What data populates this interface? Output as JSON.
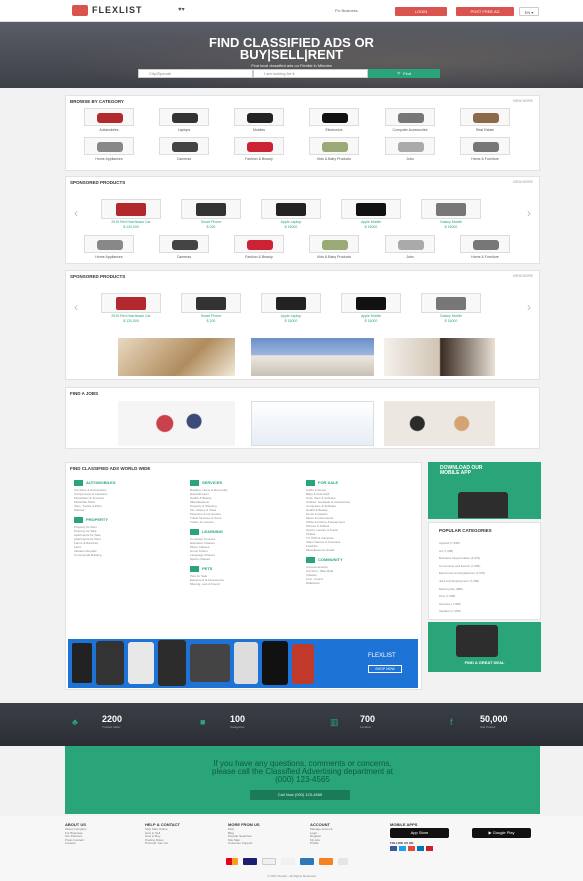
{
  "header": {
    "logo_text": "FLEXLIST",
    "link_label": "Fix Business",
    "login_label": "LOGIN",
    "post_label": "POST FREE AD",
    "lang_label": "EN ▾"
  },
  "hero": {
    "title_line1": "FIND CLASSIFIED ADS OR",
    "title_line2": "BUY|SELL|RENT",
    "subtitle": "Find local classified ads on Flexlist in Minutes",
    "city_placeholder": "City/Zipcode",
    "keyword_placeholder": "I am looking for it",
    "search_label": "Find"
  },
  "categories": {
    "title": "BROWSE BY CATEGORY",
    "more": "VIEW MORE",
    "row1": [
      "Automobiles",
      "Laptops",
      "Mobiles",
      "Electronics",
      "Computer Accessories",
      "Real Estate"
    ],
    "row2": [
      "Home Appliances",
      "Cameras",
      "Fashion & Beauty",
      "Kids & Baby Products",
      "Jobs",
      "Home & Furniture"
    ]
  },
  "sponsored1": {
    "title": "SPONSORED PRODUCTS",
    "more": "VIEW MORE",
    "products": [
      {
        "name": "2019 Red Hatchback Car",
        "price": "$ 120,000"
      },
      {
        "name": "Smart Phone",
        "price": "$ 200"
      },
      {
        "name": "Apple Laptop",
        "price": "$ 15000"
      },
      {
        "name": "Apple Mobile",
        "price": "$ 15000"
      },
      {
        "name": "Galaxy Mobile",
        "price": "$ 15000"
      }
    ],
    "row2": [
      "Home Appliances",
      "Cameras",
      "Fashion & Beauty",
      "Kids & Baby Products",
      "Jobs",
      "Home & Furniture"
    ]
  },
  "sponsored2": {
    "title": "SPONSORED PRODUCTS",
    "more": "VIEW MORE",
    "products": [
      {
        "name": "2019 Red Hatchback Car",
        "price": "$ 120,000"
      },
      {
        "name": "Smart Phone",
        "price": "$ 200"
      },
      {
        "name": "Apple Laptop",
        "price": "$ 15000"
      },
      {
        "name": "Apple Mobile",
        "price": "$ 15000"
      },
      {
        "name": "Galaxy Mobile",
        "price": "$ 15000"
      }
    ]
  },
  "jobs": {
    "title": "FIND A JOBS"
  },
  "worldwide": {
    "title": "FIND CLASSIFIED ADS WORLD WIDE",
    "columns": [
      {
        "heading": "AUTOMOBILES",
        "items": [
          "Car Parts & Accessories",
          "Campervans & Caravans",
          "Motorbikes & Scooters",
          "Motorbike Parts",
          "Vans, Trucks & Plant",
          "Wanted"
        ],
        "heading2": "PROPERTY",
        "items2": [
          "Property for Rent",
          "Property for Sale",
          "Apartments for Sale",
          "Apartments for Rent",
          "Farms & Ranches",
          "Land",
          "Vacation Rentals",
          "Commercial Building"
        ]
      },
      {
        "heading": "SERVICES",
        "items": [
          "Building, Home & Removals",
          "Entertainment",
          "Health & Beauty",
          "Miscellaneous",
          "Property & Shipping",
          "Tax, Money & Visas",
          "Telecoms & Computers",
          "Travel Services & Tours",
          "Tuition & Lessons"
        ],
        "heading2": "LEARNING",
        "items2": [
          "Computer Courses",
          "Education Classes",
          "Music Classes",
          "Home Tuition",
          "Language Classes",
          "Sports Classes"
        ],
        "heading3": "PETS",
        "items3": [
          "Pets for Sale",
          "Equipment & Accessories",
          "Missing, Lost & Found"
        ]
      },
      {
        "heading": "FOR SALE",
        "items": [
          "Audio & Stereo",
          "Baby & Kids Stuff",
          "Cars, Vans & Vehicles",
          "Clothes, Footwear & Accessories",
          "Computers & Software",
          "Health & Beauty",
          "Home & Garden",
          "Music & Instruments",
          "Office Furniture & Equipment",
          "Phones & Tablets",
          "Sports, Leisure & Travel",
          "Tickets",
          "TV, DVD & Cameras",
          "Video Games & Consoles",
          "Freebies",
          "Miscellaneous Goods"
        ],
        "heading2": "COMMUNITY",
        "items2": [
          "Announcements",
          "Car Pool - Bike Ride",
          "Classes",
          "Lost - Found",
          "Rideshare"
        ]
      }
    ]
  },
  "right_panel": {
    "download_title": "DOWNLOAD OUR MOBILE APP",
    "popular_title": "POPULAR CATEGORIES",
    "popular": [
      "Apparel (7,398)",
      "Art (7,398)",
      "Business Opportunities (4,079)",
      "Community and Events (7,096)",
      "Electronics and Appliances (7,076)",
      "Jobs And Employment (7,096)",
      "Motorcycles (988)",
      "Pets (7,358)",
      "Services (7,358)",
      "Vacation (7,358)"
    ],
    "deal_title": "FIND A GREAT DEAL"
  },
  "banner": {
    "line1": "FLEXLIST",
    "cta": "SHOP NOW"
  },
  "stats": [
    {
      "value": "2200",
      "label": "Trusted Seller"
    },
    {
      "value": "100",
      "label": "Categories"
    },
    {
      "value": "700",
      "label": "Location"
    },
    {
      "value": "50,000",
      "label": "Ads Posted"
    }
  ],
  "contact": {
    "line1": "If you have any questions, comments or concerns,",
    "line2": "please call the Classified Advertising department at",
    "line3": "(000) 123-4565",
    "button": "Call Now (000) 123-4565"
  },
  "footer": {
    "cols": [
      {
        "heading": "ABOUT US",
        "items": [
          "About Company",
          "For Business",
          "Our Partners",
          "Press Contact",
          "Careers"
        ]
      },
      {
        "heading": "HELP & CONTACT",
        "items": [
          "Stay Safe Online",
          "How to Sell",
          "How to Buy",
          "Posting Rules",
          "Promote Your Ad"
        ]
      },
      {
        "heading": "MORE FROM US",
        "items": [
          "FAQ",
          "Blog",
          "Popular Searches",
          "Site Map",
          "Customer Support"
        ]
      },
      {
        "heading": "ACCOUNT",
        "items": [
          "Manage Account",
          "Login",
          "Register",
          "My Ads",
          "Profile"
        ]
      }
    ],
    "mobile_heading": "MOBILE APPS",
    "appstore": "App Store",
    "googleplay": "Google Play",
    "social_heading": "FOLLOW US ON",
    "copyright": "© 2017 Flexlist - All Rights Reserved"
  }
}
